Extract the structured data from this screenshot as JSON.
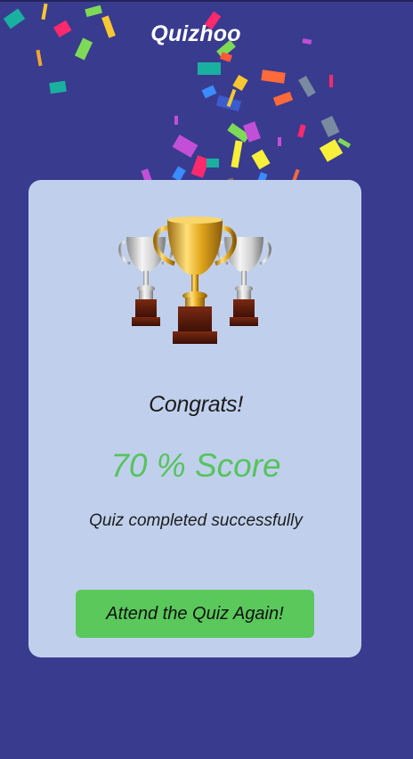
{
  "app": {
    "title": "Quizhoo"
  },
  "result": {
    "congrats": "Congrats!",
    "score_text": "70 % Score",
    "score_percent": 70,
    "message": "Quiz completed successfully"
  },
  "actions": {
    "retry_label": "Attend the Quiz Again!"
  },
  "theme": {
    "background": "#393B8E",
    "card": "#C0D0EC",
    "accent_green": "#57C35E",
    "button_green": "#5AC85B"
  },
  "icons": {
    "trophy": "trophy-icon",
    "confetti": "confetti-decoration"
  }
}
